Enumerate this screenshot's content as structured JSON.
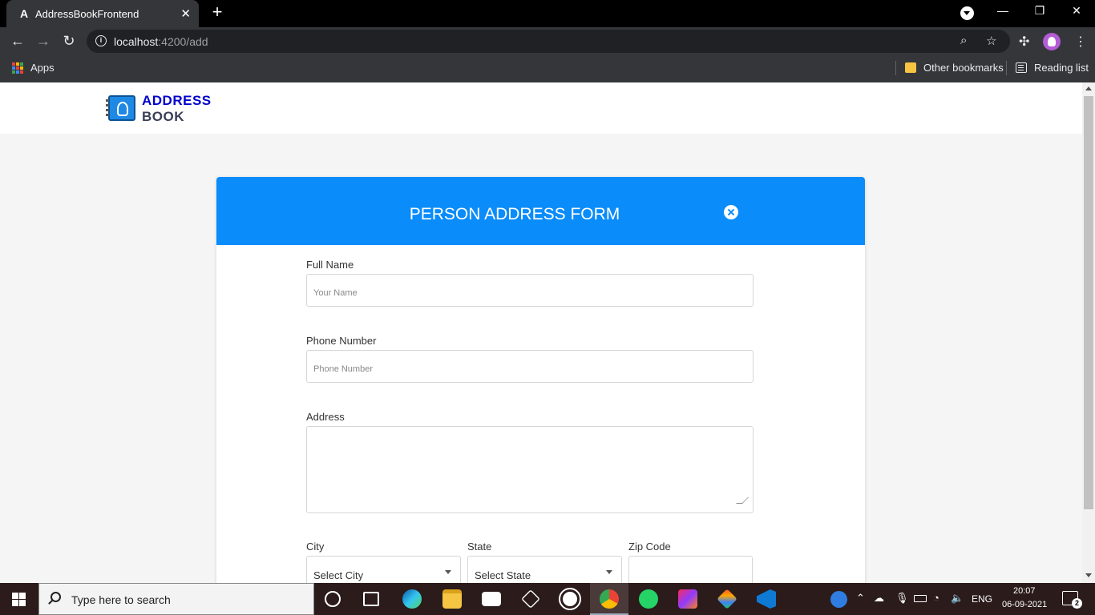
{
  "browser": {
    "tab_title": "AddressBookFrontend",
    "url_host": "localhost",
    "url_path": ":4200/add",
    "bookmarks": {
      "apps_label": "Apps",
      "other_bookmarks_label": "Other bookmarks",
      "reading_list_label": "Reading list"
    }
  },
  "app": {
    "logo_line1": "ADDRESS",
    "logo_line2": "BOOK",
    "brand_color": "#0000cc"
  },
  "form": {
    "title": "PERSON ADDRESS FORM",
    "header_color": "#0a8cfa",
    "full_name": {
      "label": "Full Name",
      "placeholder": "Your Name",
      "value": ""
    },
    "phone": {
      "label": "Phone Number",
      "placeholder": "Phone Number",
      "value": ""
    },
    "address": {
      "label": "Address",
      "value": ""
    },
    "city": {
      "label": "City",
      "selected": "Select City"
    },
    "state": {
      "label": "State",
      "selected": "Select State"
    },
    "zip": {
      "label": "Zip Code",
      "value": ""
    }
  },
  "taskbar": {
    "search_placeholder": "Type here to search",
    "language": "ENG",
    "time": "20:07",
    "date": "06-09-2021",
    "notification_count": "2"
  }
}
